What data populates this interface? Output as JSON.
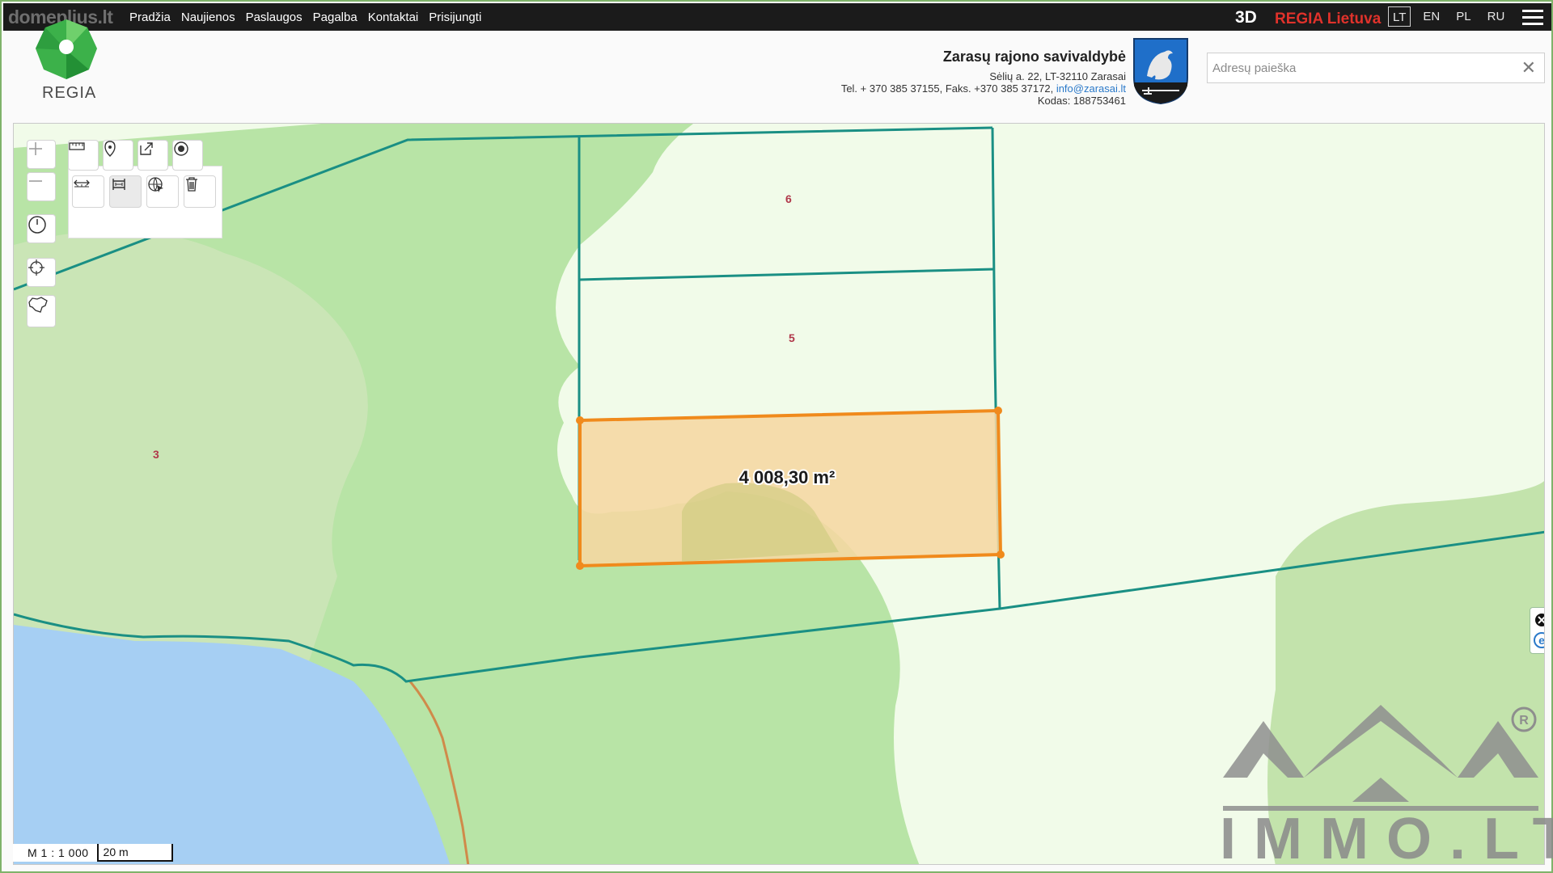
{
  "watermark": "domeplius.lt",
  "nav": {
    "items": [
      "Pradžia",
      "Naujienos",
      "Paslaugos",
      "Pagalba",
      "Kontaktai",
      "Prisijungti"
    ],
    "mode_3d": "3D",
    "regia_lietuva": "REGIA Lietuva",
    "languages": [
      "LT",
      "EN",
      "PL",
      "RU"
    ],
    "active_language": "LT",
    "menu_icon": "hamburger-icon"
  },
  "header": {
    "logo_text": "REGIA",
    "municipality": {
      "name": "Zarasų rajono savivaldybė",
      "address": "Sėlių a. 22, LT-32110 Zarasai",
      "phones": "Tel. + 370 385 37155, Faks. +370 385 37172,",
      "email": "info@zarasai.lt",
      "code": "Kodas: 188753461"
    },
    "search": {
      "placeholder": "Adresų paieška",
      "value": ""
    }
  },
  "map": {
    "parcel_labels": [
      "6",
      "5",
      "3"
    ],
    "measurement": "4 008,30 m²",
    "scale_ratio": "M 1 : 1 000",
    "scale_length": "20 m",
    "toolbar": {
      "zoom_in": "plus-icon",
      "zoom_out": "minus-icon",
      "row1": [
        "ruler-icon",
        "pin-icon",
        "share-icon",
        "radio-target-icon"
      ],
      "row2": [
        "measure-distance-icon",
        "measure-area-icon",
        "globe-pointer-icon",
        "trash-icon"
      ],
      "side": [
        "history-icon",
        "crosshair-icon",
        "lithuania-map-icon"
      ]
    },
    "attribution_icons": [
      "close-icon",
      "info-e-icon"
    ],
    "colors": {
      "forest": "#b8e4a6",
      "meadow": "#c9e3b2",
      "open_land": "#f1fbe9",
      "water": "#a6cff3",
      "parcel_line": "#1a8f84",
      "selection_fill": "#f5d7a2",
      "selection_stroke": "#f08a1c"
    }
  },
  "brand_watermark": "IMMO.LT"
}
